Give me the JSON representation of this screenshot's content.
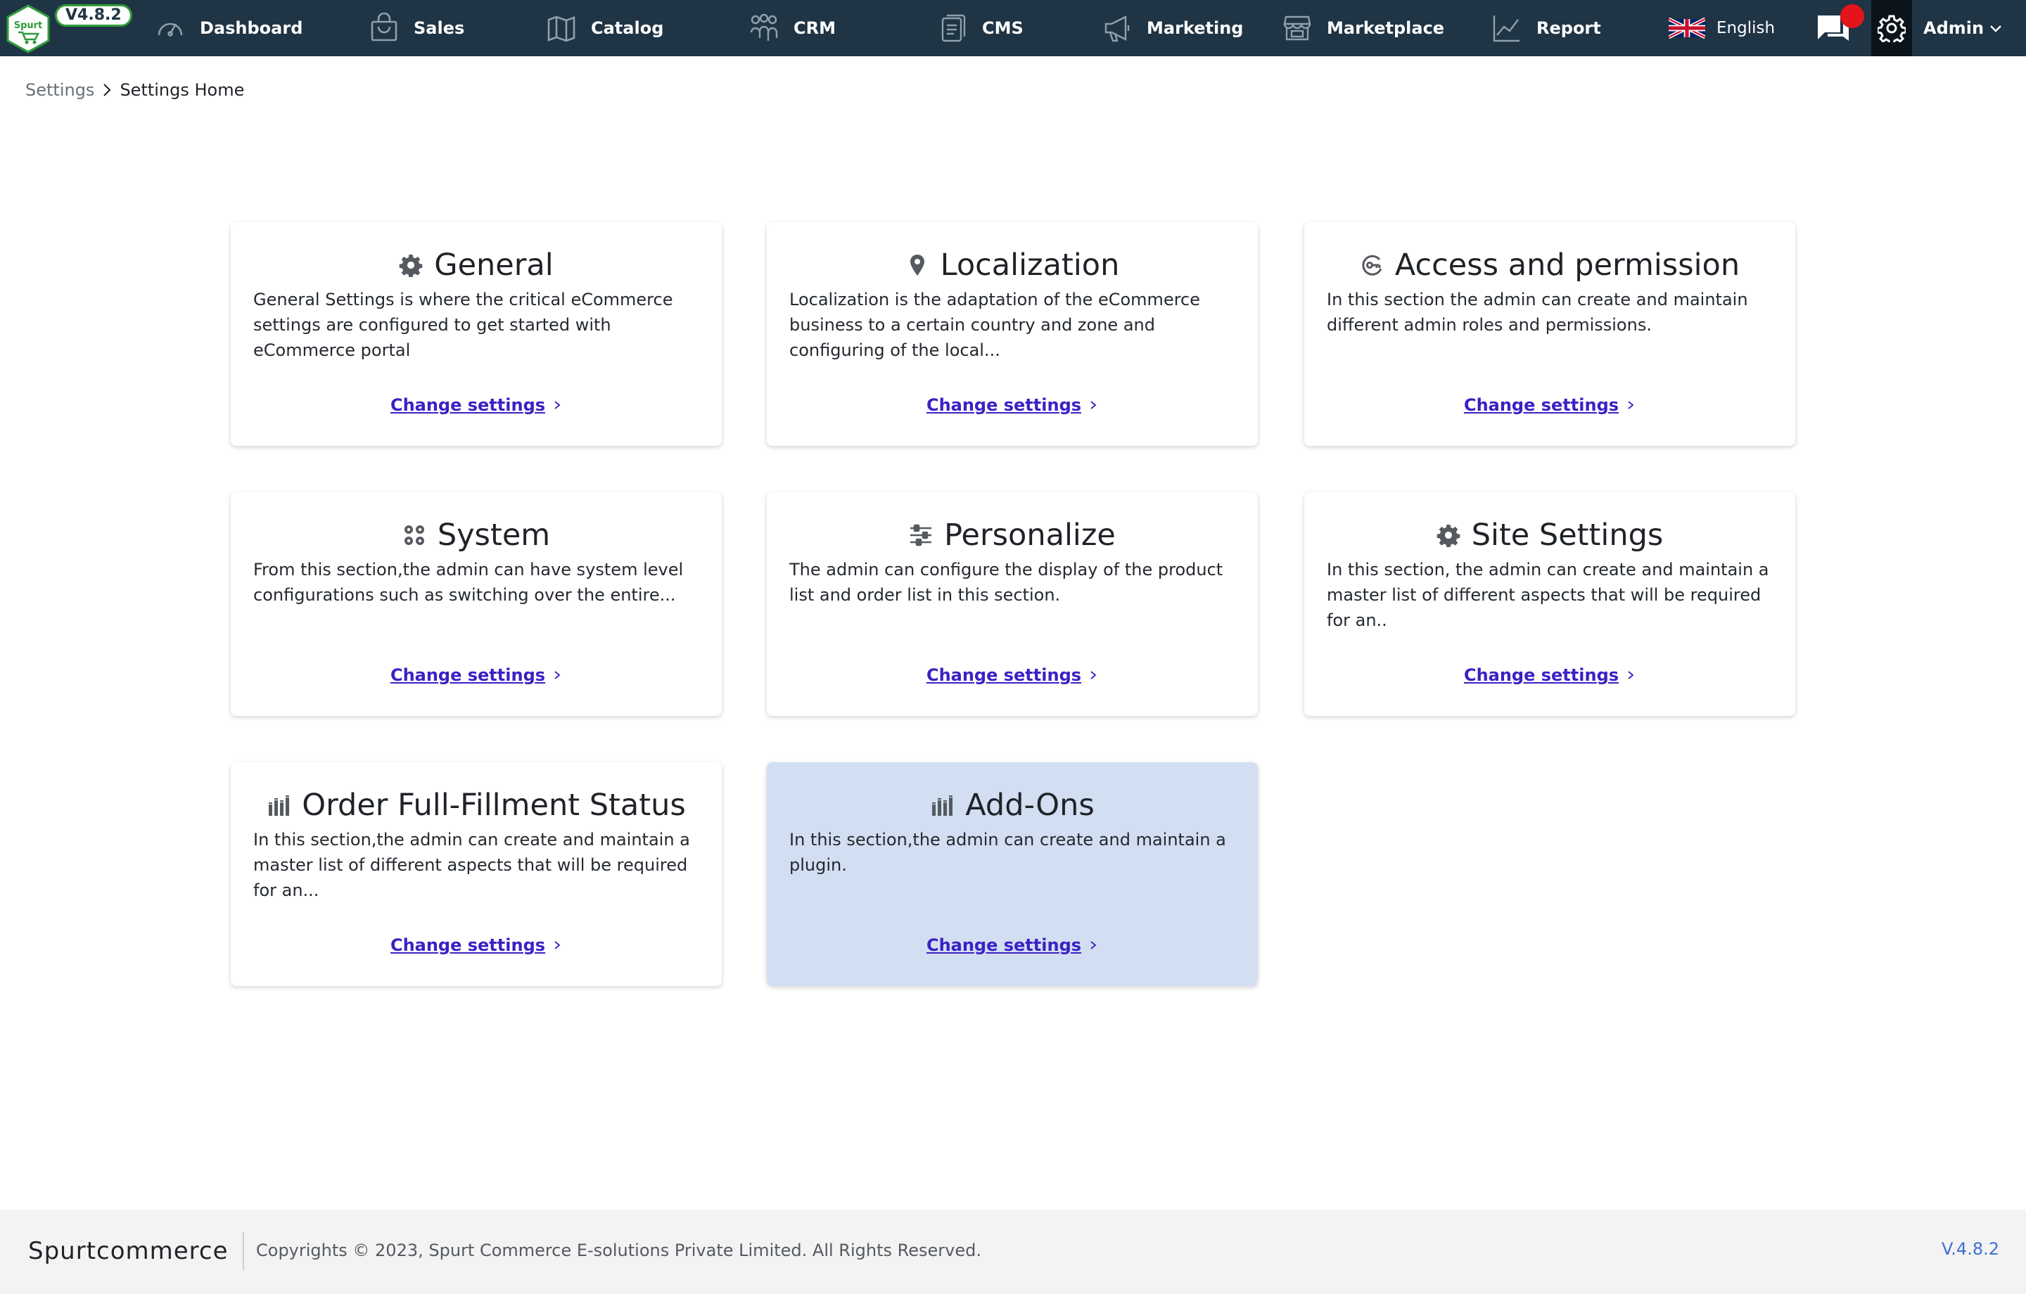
{
  "header": {
    "logo_text": "Spurt",
    "version_badge": "V4.8.2",
    "nav": [
      {
        "label": "Dashboard",
        "icon": "gauge-icon"
      },
      {
        "label": "Sales",
        "icon": "shopping-bag-icon"
      },
      {
        "label": "Catalog",
        "icon": "map-icon"
      },
      {
        "label": "CRM",
        "icon": "users-icon"
      },
      {
        "label": "CMS",
        "icon": "document-icon"
      },
      {
        "label": "Marketing",
        "icon": "megaphone-icon"
      },
      {
        "label": "Marketplace",
        "icon": "store-icon"
      },
      {
        "label": "Report",
        "icon": "trend-chart-icon"
      }
    ],
    "language": "English",
    "user": "Admin"
  },
  "breadcrumb": {
    "parent": "Settings",
    "current": "Settings Home"
  },
  "cards": [
    {
      "title": "General",
      "icon": "cog-icon",
      "description": "General Settings is where the critical eCommerce settings are configured to get started with eCommerce portal",
      "link": "Change settings"
    },
    {
      "title": "Localization",
      "icon": "map-pin-icon",
      "description": "Localization is the adaptation of the eCommerce business to a certain country and zone and configuring of the local...",
      "link": "Change settings"
    },
    {
      "title": "Access and permission",
      "icon": "key-circle-icon",
      "description": "In this section the admin can create and maintain different admin roles and permissions.",
      "link": "Change settings"
    },
    {
      "title": "System",
      "icon": "cogs-icon",
      "description": "From this section,the admin can have system level configurations such as switching over the entire...",
      "link": "Change settings"
    },
    {
      "title": "Personalize",
      "icon": "sliders-icon",
      "description": "The admin can configure the display of the product list and order list in this section.",
      "link": "Change settings"
    },
    {
      "title": "Site Settings",
      "icon": "cog-icon",
      "description": "In this section, the admin can create and maintain a master list of different aspects that will be required for an..",
      "link": "Change settings"
    },
    {
      "title": "Order Full-Fillment Status",
      "icon": "bars-icon",
      "description": "In this section,the admin can create and maintain a master list of different aspects that will be required for an...",
      "link": "Change settings"
    },
    {
      "title": "Add-Ons",
      "icon": "bars-icon",
      "description": "In this section,the admin can create and maintain a plugin.",
      "link": "Change settings"
    }
  ],
  "footer": {
    "brand": "Spurtcommerce",
    "copyright": "Copyrights © 2023, Spurt Commerce E-solutions Private Limited. All Rights Reserved.",
    "version": "V.4.8.2"
  },
  "colors": {
    "nav_bg": "#1f3444",
    "link": "#3b21c4",
    "highlight_card": "#d2dff2",
    "notification": "#e3141a"
  }
}
